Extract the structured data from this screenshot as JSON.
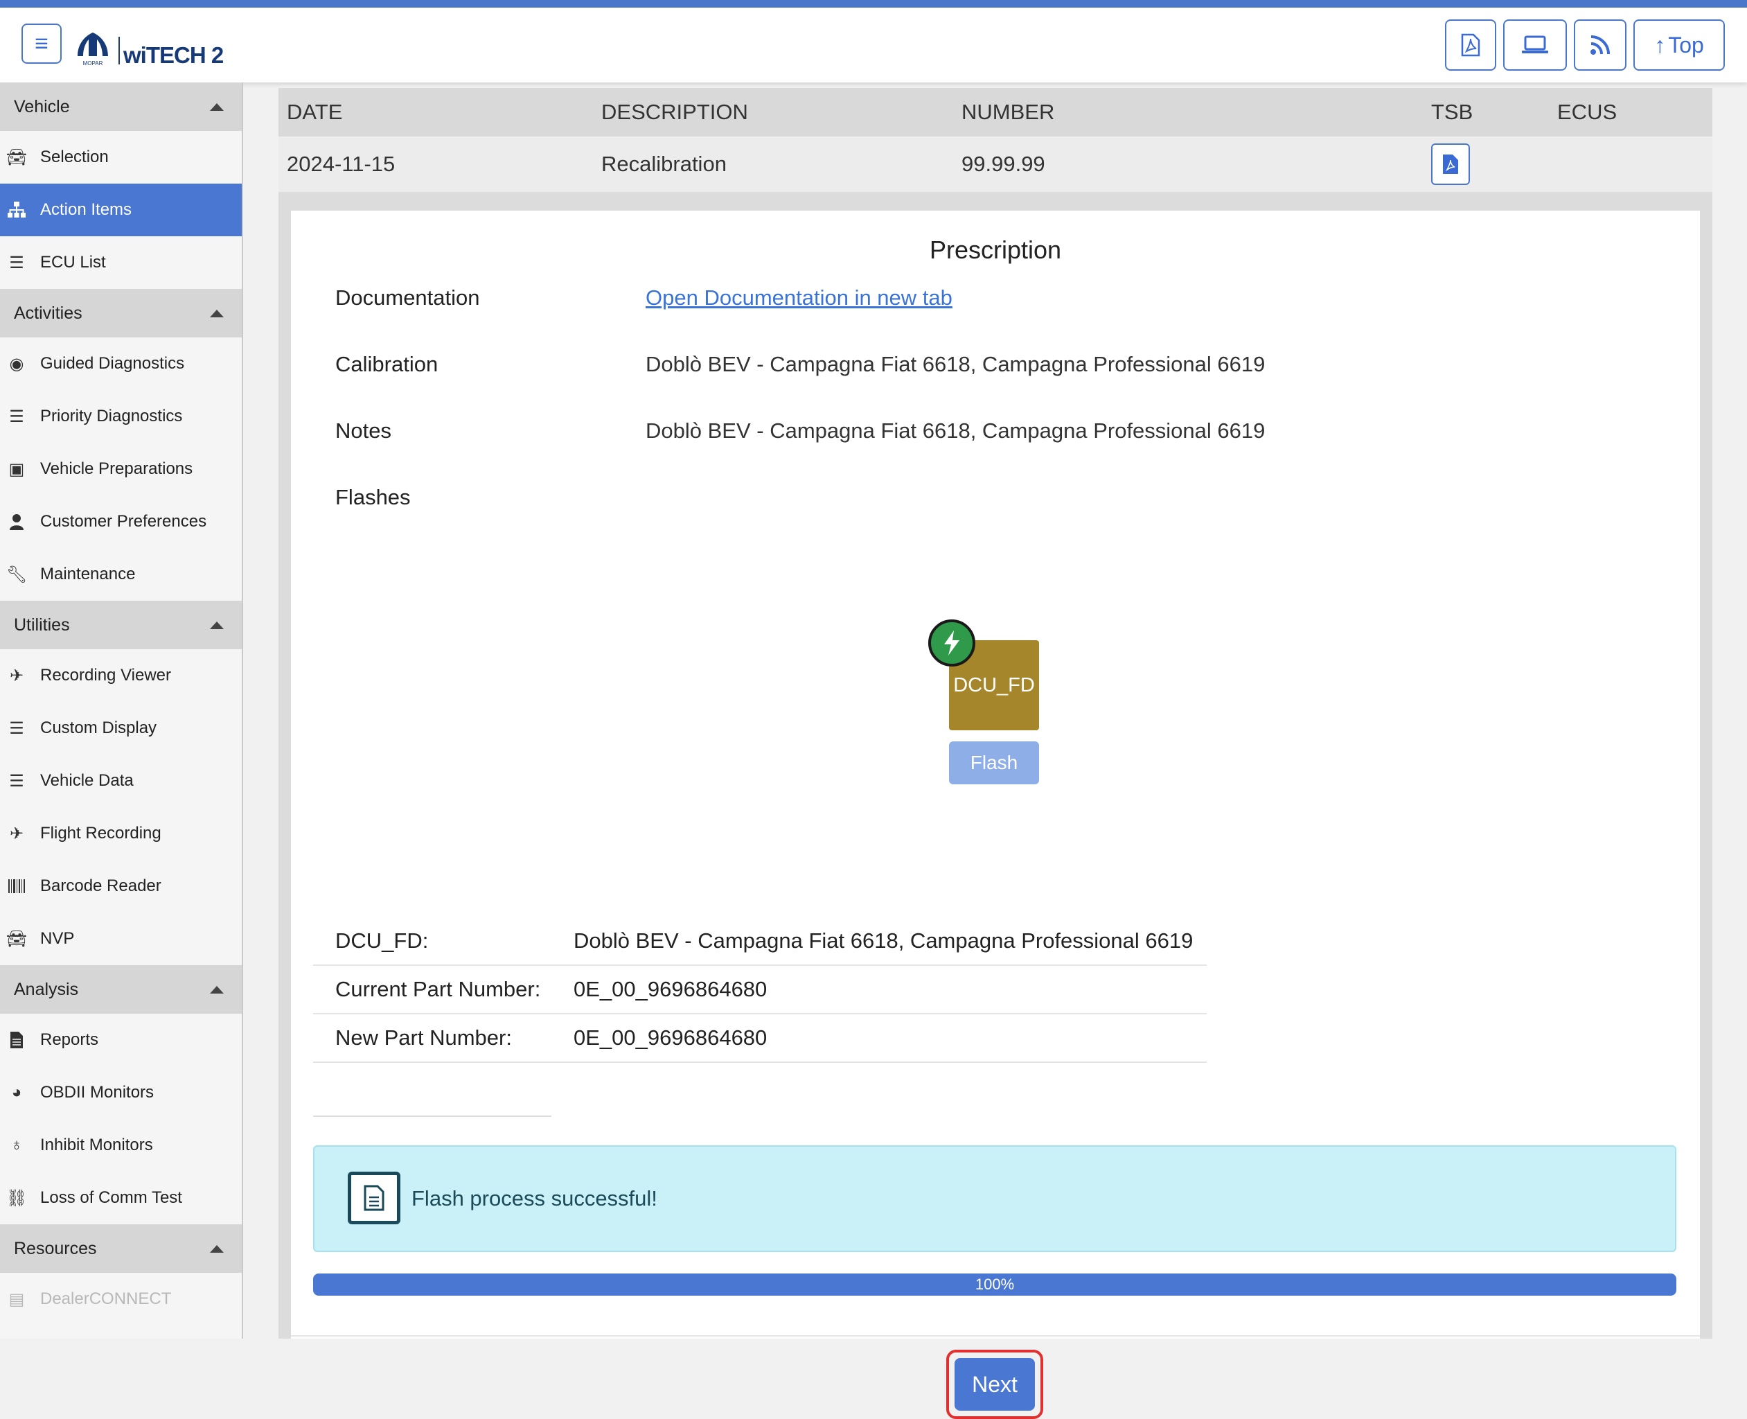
{
  "header": {
    "brand_mopar": "MOPAR",
    "brand_witech": "wiTECH 2",
    "top_button_label": "Top"
  },
  "sidebar": {
    "sections": [
      {
        "title": "Vehicle",
        "items": [
          {
            "label": "Selection",
            "icon": "car-icon"
          },
          {
            "label": "Action Items",
            "icon": "sitemap-icon",
            "active": true
          },
          {
            "label": "ECU List",
            "icon": "list-icon"
          }
        ]
      },
      {
        "title": "Activities",
        "items": [
          {
            "label": "Guided Diagnostics",
            "icon": "compass-icon"
          },
          {
            "label": "Priority Diagnostics",
            "icon": "bars-icon"
          },
          {
            "label": "Vehicle Preparations",
            "icon": "medkit-icon"
          },
          {
            "label": "Customer Preferences",
            "icon": "user-icon"
          },
          {
            "label": "Maintenance",
            "icon": "wrench-icon"
          }
        ]
      },
      {
        "title": "Utilities",
        "items": [
          {
            "label": "Recording Viewer",
            "icon": "plane-icon"
          },
          {
            "label": "Custom Display",
            "icon": "list-ol-icon"
          },
          {
            "label": "Vehicle Data",
            "icon": "list-ol-icon"
          },
          {
            "label": "Flight Recording",
            "icon": "plane-icon"
          },
          {
            "label": "Barcode Reader",
            "icon": "barcode-icon"
          },
          {
            "label": "NVP",
            "icon": "car-icon"
          }
        ]
      },
      {
        "title": "Analysis",
        "items": [
          {
            "label": "Reports",
            "icon": "file-icon"
          },
          {
            "label": "OBDII Monitors",
            "icon": "gauge-icon"
          },
          {
            "label": "Inhibit Monitors",
            "icon": "stethoscope-icon"
          },
          {
            "label": "Loss of Comm Test",
            "icon": "link-icon"
          }
        ]
      },
      {
        "title": "Resources",
        "items": [
          {
            "label": "DealerCONNECT",
            "icon": "book-icon",
            "disabled": true
          }
        ]
      }
    ]
  },
  "table": {
    "headers": {
      "date": "DATE",
      "description": "DESCRIPTION",
      "number": "NUMBER",
      "tsb": "TSB",
      "ecus": "ECUS"
    },
    "row": {
      "date": "2024-11-15",
      "description": "Recalibration",
      "number": "99.99.99"
    }
  },
  "prescription": {
    "title": "Prescription",
    "documentation_label": "Documentation",
    "documentation_link": "Open Documentation in new tab",
    "calibration_label": "Calibration",
    "calibration_value": "Doblò BEV - Campagna Fiat 6618, Campagna Professional 6619",
    "notes_label": "Notes",
    "notes_value": "Doblò BEV - Campagna Fiat 6618, Campagna Professional 6619",
    "flashes_label": "Flashes",
    "ecu_name": "DCU_FD",
    "flash_button": "Flash"
  },
  "part_numbers": [
    {
      "key": "DCU_FD:",
      "value": "Doblò BEV - Campagna Fiat 6618, Campagna Professional 6619"
    },
    {
      "key": "Current Part Number:",
      "value": "0E_00_9696864680"
    },
    {
      "key": "New Part Number:",
      "value": "0E_00_9696864680"
    }
  ],
  "status": {
    "message": "Flash process successful!",
    "progress_percent": 100,
    "progress_label": "100%"
  },
  "footer": {
    "next_button": "Next"
  },
  "colors": {
    "accent": "#4a77d2",
    "ecu_tile": "#a5862a",
    "success_badge": "#2e9a4a",
    "alert_bg": "#caf1f8",
    "highlight": "#e03030"
  }
}
